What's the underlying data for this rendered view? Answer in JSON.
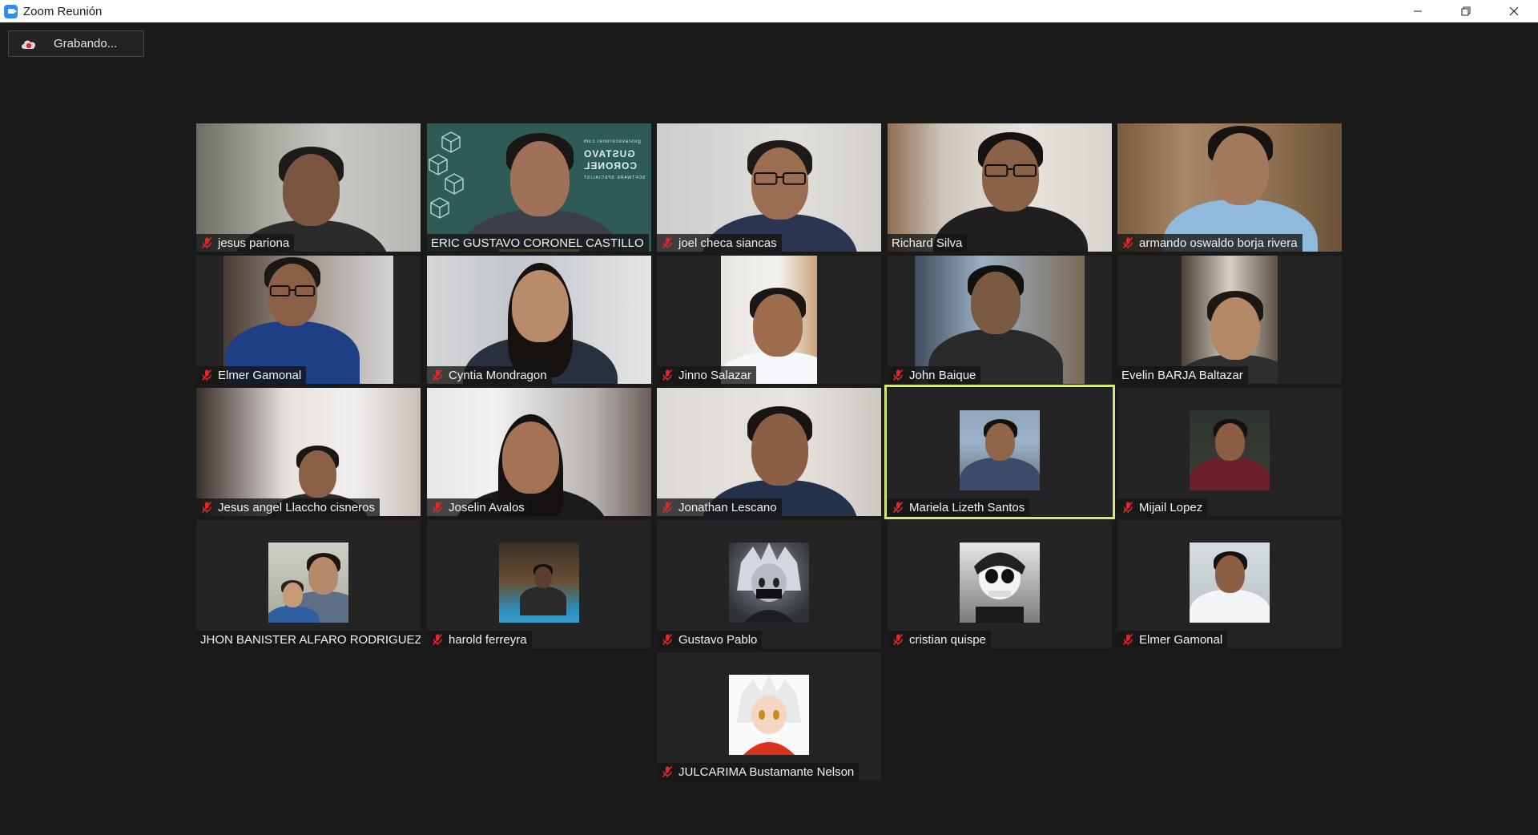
{
  "window": {
    "title": "Zoom Reunión",
    "controls": [
      "minimize",
      "restore",
      "close"
    ]
  },
  "recording": {
    "label": "Grabando..."
  },
  "participants": [
    {
      "name": "jesus pariona",
      "muted": true
    },
    {
      "name": "ERIC GUSTAVO CORONEL CASTILLO",
      "muted": false,
      "speaking": true
    },
    {
      "name": "joel checa siancas",
      "muted": true
    },
    {
      "name": "Richard Silva",
      "muted": false
    },
    {
      "name": "armando oswaldo borja rivera",
      "muted": true
    },
    {
      "name": "Elmer Gamonal",
      "muted": true
    },
    {
      "name": "Cyntia Mondragon",
      "muted": true
    },
    {
      "name": "Jinno Salazar",
      "muted": true
    },
    {
      "name": "John Baique",
      "muted": true
    },
    {
      "name": "Evelin BARJA  Baltazar",
      "muted": false
    },
    {
      "name": "Jesus angel Llaccho cisneros",
      "muted": true
    },
    {
      "name": "Joselin Avalos",
      "muted": true
    },
    {
      "name": "Jonathan Lescano",
      "muted": true
    },
    {
      "name": "Mariela Lizeth Santos",
      "muted": true,
      "active": true
    },
    {
      "name": "Mijail Lopez",
      "muted": true
    },
    {
      "name": "JHON BANISTER ALFARO RODRIGUEZ",
      "muted": false
    },
    {
      "name": "harold ferreyra",
      "muted": true
    },
    {
      "name": "Gustavo Pablo",
      "muted": true
    },
    {
      "name": "cristian quispe",
      "muted": true
    },
    {
      "name": "Elmer Gamonal",
      "muted": true
    },
    {
      "name": "JULCARIMA Bustamante Nelson",
      "muted": true
    }
  ],
  "slide_text": {
    "brand_line1": "GUSTAVO",
    "brand_line2": "CORONEL",
    "brand_sub": "SOFTWARE SPECIALIST",
    "brand_url": "gustavocoronel.com"
  },
  "colors": {
    "accent": "#2D8CFF",
    "mute_icon": "#e02828",
    "active_outline": "#d2ea72",
    "speaking_bar": "#f1e26a"
  }
}
